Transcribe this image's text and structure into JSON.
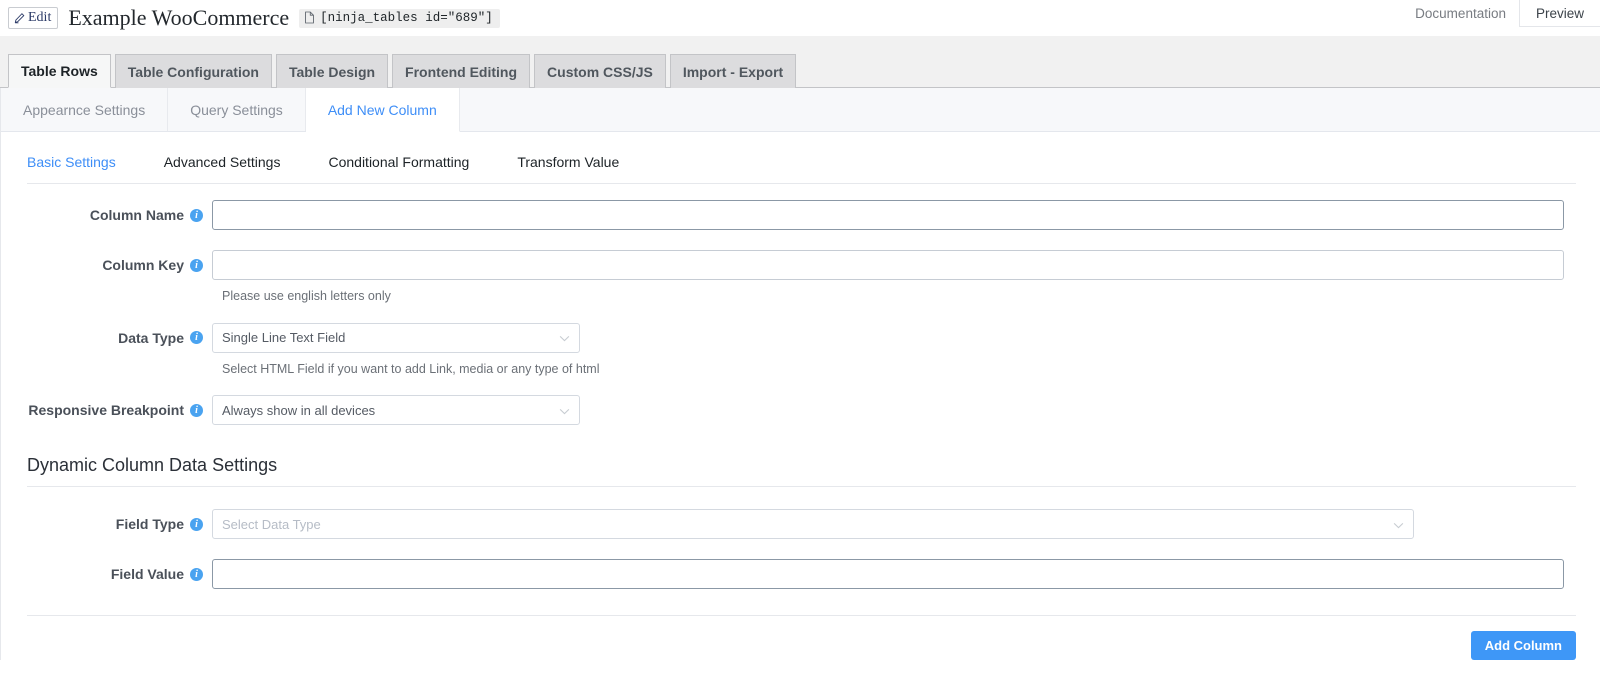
{
  "header": {
    "edit_label": "Edit",
    "title": "Example WooCommerce",
    "shortcode": "[ninja_tables id=\"689\"]",
    "documentation_label": "Documentation",
    "preview_label": "Preview"
  },
  "nav_tabs": [
    {
      "label": "Table Rows",
      "active": true
    },
    {
      "label": "Table Configuration",
      "active": false
    },
    {
      "label": "Table Design",
      "active": false
    },
    {
      "label": "Frontend Editing",
      "active": false
    },
    {
      "label": "Custom CSS/JS",
      "active": false
    },
    {
      "label": "Import - Export",
      "active": false
    }
  ],
  "sub_tabs": [
    {
      "label": "Appearnce Settings",
      "active": false
    },
    {
      "label": "Query Settings",
      "active": false
    },
    {
      "label": "Add New Column",
      "active": true
    }
  ],
  "inner_tabs": [
    {
      "label": "Basic Settings",
      "active": true
    },
    {
      "label": "Advanced Settings",
      "active": false
    },
    {
      "label": "Conditional Formatting",
      "active": false
    },
    {
      "label": "Transform Value",
      "active": false
    }
  ],
  "form": {
    "column_name": {
      "label": "Column Name",
      "value": "",
      "placeholder": ""
    },
    "column_key": {
      "label": "Column Key",
      "value": "",
      "placeholder": "",
      "help": "Please use english letters only"
    },
    "data_type": {
      "label": "Data Type",
      "value": "Single Line Text Field",
      "help": "Select HTML Field if you want to add Link, media or any type of html"
    },
    "responsive_breakpoint": {
      "label": "Responsive Breakpoint",
      "value": "Always show in all devices"
    }
  },
  "dynamic_section": {
    "title": "Dynamic Column Data Settings",
    "field_type": {
      "label": "Field Type",
      "value": "",
      "placeholder": "Select Data Type"
    },
    "field_value": {
      "label": "Field Value",
      "value": "",
      "placeholder": ""
    }
  },
  "footer": {
    "add_column_label": "Add Column"
  },
  "colors": {
    "accent": "#3e97f7",
    "info_icon": "#4aa3f0",
    "tab_bar_bg": "#f1f1f1",
    "subnav_bg": "#f7f8fa"
  },
  "info_tooltip_char": "i"
}
